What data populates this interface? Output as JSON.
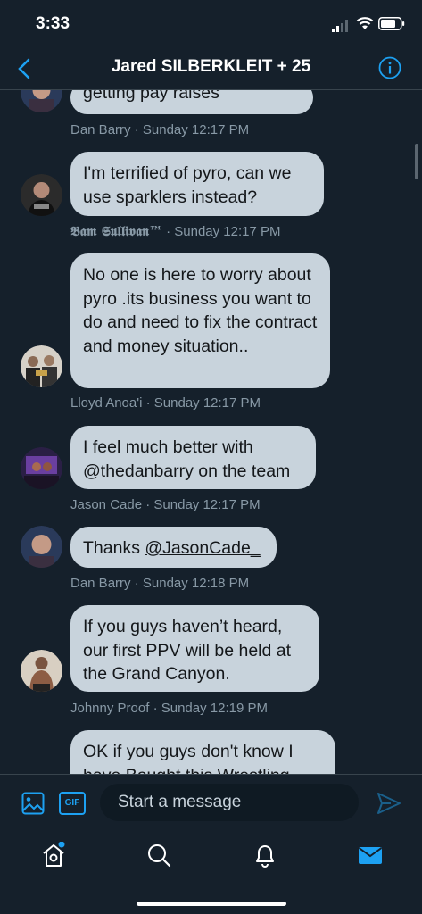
{
  "status": {
    "time": "3:33"
  },
  "header": {
    "title": "Jared SILBERKLEIT + 25"
  },
  "messages": [
    {
      "text": "getting pay raises",
      "sender": "Dan Barry",
      "time": "Sunday 12:17 PM"
    },
    {
      "text": "I'm terrified of pyro, can we use sparklers instead?",
      "sender": "𝕭𝖆𝖒 𝕾𝖚𝖑𝖑𝖎𝖛𝖆𝖓™",
      "time": "Sunday 12:17 PM"
    },
    {
      "text": "No one is here to worry about pyro .its business you want to do and need to fix the contract and money situation..",
      "sender": "Lloyd Anoa'i",
      "time": "Sunday 12:17 PM"
    },
    {
      "text_before": "I feel much better with ",
      "mention": "@thedanbarry",
      "text_after": " on the team",
      "sender": "Jason Cade",
      "time": "Sunday 12:17 PM"
    },
    {
      "text_before": "Thanks ",
      "mention": "@JasonCade_",
      "sender": "Dan Barry",
      "time": "Sunday 12:18 PM"
    },
    {
      "text": "If you guys haven’t heard, our first PPV will be held at the Grand Canyon.",
      "sender": "Johnny Proof",
      "time": "Sunday 12:19 PM"
    },
    {
      "text": "OK if you guys don't know I have Bought this Wrestling"
    }
  ],
  "composer": {
    "placeholder": "Start a message",
    "gif_label": "GIF"
  },
  "icons": {
    "back": "chevron-left-icon",
    "info": "info-icon",
    "image": "image-icon",
    "send": "send-icon",
    "home": "home-icon",
    "search": "search-icon",
    "notifications": "bell-icon",
    "messages": "mail-icon"
  },
  "colors": {
    "accent": "#1da1f2",
    "background": "#15202b",
    "bubble": "#c8d3dc",
    "meta": "#8899a6"
  }
}
